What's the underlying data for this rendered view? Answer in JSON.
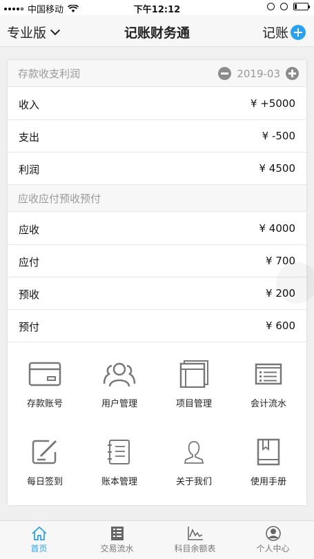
{
  "status_bar": {
    "carrier": "中国移动",
    "time": "下午12:12"
  },
  "nav": {
    "edition": "专业版",
    "title": "记账财务通",
    "record": "记账"
  },
  "deposit_section": {
    "title": "存款收支利润",
    "month": "2019-03",
    "rows": [
      {
        "label": "收入",
        "value": "¥ +5000"
      },
      {
        "label": "支出",
        "value": "¥ -500"
      },
      {
        "label": "利润",
        "value": "¥ 4500"
      }
    ]
  },
  "receivable_section": {
    "title": "应收应付预收预付",
    "rows": [
      {
        "label": "应收",
        "value": "¥ 4000"
      },
      {
        "label": "应付",
        "value": "¥ 700"
      },
      {
        "label": "预收",
        "value": "¥ 200"
      },
      {
        "label": "预付",
        "value": "¥ 600"
      }
    ]
  },
  "grid": [
    {
      "label": "存款账号",
      "icon": "card-icon"
    },
    {
      "label": "用户管理",
      "icon": "users-icon"
    },
    {
      "label": "项目管理",
      "icon": "project-icon"
    },
    {
      "label": "会计流水",
      "icon": "ledger-icon"
    },
    {
      "label": "每日签到",
      "icon": "sign-in-icon"
    },
    {
      "label": "账本管理",
      "icon": "notebook-icon"
    },
    {
      "label": "关于我们",
      "icon": "person-icon"
    },
    {
      "label": "使用手册",
      "icon": "manual-icon"
    }
  ],
  "tabs": [
    {
      "label": "首页",
      "icon": "home-icon",
      "active": true
    },
    {
      "label": "交易流水",
      "icon": "transactions-icon",
      "active": false
    },
    {
      "label": "科目余额表",
      "icon": "chart-icon",
      "active": false
    },
    {
      "label": "个人中心",
      "icon": "profile-icon",
      "active": false
    }
  ],
  "colors": {
    "accent": "#2aa3ef",
    "icon_gray": "#777777"
  }
}
